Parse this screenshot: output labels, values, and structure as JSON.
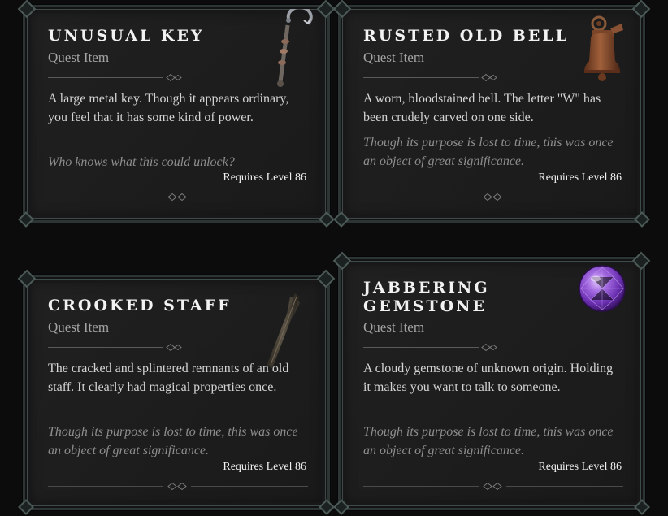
{
  "cards": [
    {
      "title": "Unusual Key",
      "type": "Quest Item",
      "description": "A large metal key. Though it appears ordinary, you feel that it has some kind of power.",
      "flavor": "Who knows what this could unlock?",
      "requirement": "Requires Level 86",
      "icon": "key-icon"
    },
    {
      "title": "Rusted Old Bell",
      "type": "Quest Item",
      "description": "A worn, bloodstained bell. The letter \"W\" has been crudely carved on one side.",
      "flavor": "Though its purpose is lost to time, this was once an object of great significance.",
      "requirement": "Requires Level 86",
      "icon": "bell-icon"
    },
    {
      "title": "Crooked Staff",
      "type": "Quest Item",
      "description": "The cracked and splintered remnants of an old staff. It clearly had magical properties once.",
      "flavor": "Though its purpose is lost to time, this was once an object of great significance.",
      "requirement": "Requires Level 86",
      "icon": "staff-icon"
    },
    {
      "title_line1": "Jabbering",
      "title_line2": "Gemstone",
      "type": "Quest Item",
      "description": "A cloudy gemstone of unknown origin. Holding it makes you want to talk to someone.",
      "flavor": "Though its purpose is lost to time, this was once an object of great significance.",
      "requirement": "Requires Level 86",
      "icon": "gemstone-icon"
    }
  ],
  "colors": {
    "background": "#0c0c0c",
    "panel": "#1c1c1c",
    "frame": "#3d4a48",
    "title": "#f2f2f2",
    "subtitle": "#a4a4a4",
    "description": "#d4d4d4",
    "flavor": "#8e8e8e",
    "gem": "#8a4fd0"
  }
}
